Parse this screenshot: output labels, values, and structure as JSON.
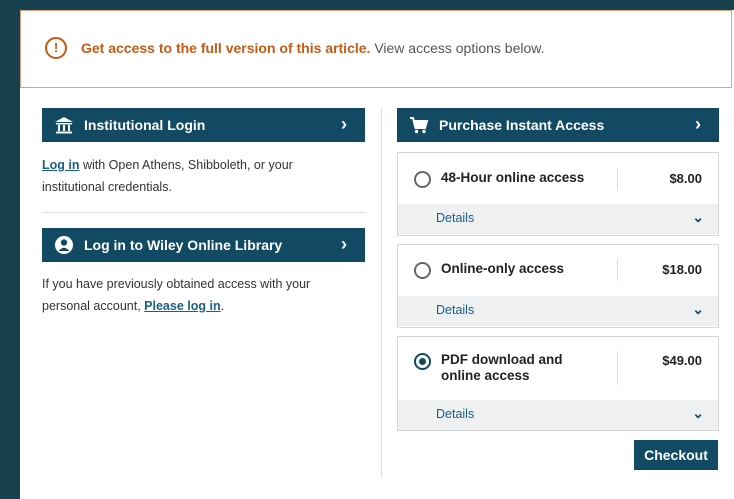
{
  "banner": {
    "icon": "info-icon",
    "strong": "Get access to the full version of this article.",
    "rest": "View access options below."
  },
  "institutional": {
    "icon": "institution-icon",
    "title": "Institutional Login",
    "login_link": "Log in",
    "text1": "with Open Athens, Shibboleth, or your",
    "text2": "institutional credentials."
  },
  "wiley": {
    "icon": "user-icon",
    "title": "Log in to Wiley Online Library",
    "text1": "If you have previously obtained access with your",
    "text2": "personal account,",
    "login_link": "Please log in",
    "text3": "."
  },
  "purchase": {
    "icon": "cart-icon",
    "title": "Purchase Instant Access",
    "options": [
      {
        "name": "48-Hour online access",
        "price": "$8.00",
        "details": "Details",
        "selected": false
      },
      {
        "name": "Online-only access",
        "price": "$18.00",
        "details": "Details",
        "selected": false
      },
      {
        "name_line1": "PDF download and",
        "name_line2": "online access",
        "price": "$49.00",
        "details": "Details",
        "selected": true
      }
    ],
    "checkout": "Checkout"
  },
  "colors": {
    "accent": "#124a64",
    "alert": "#c65a15",
    "background": "#17414f"
  }
}
